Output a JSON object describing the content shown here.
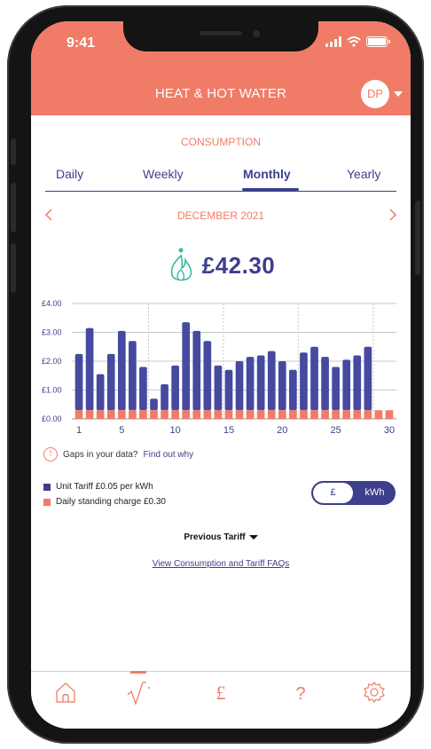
{
  "status_bar": {
    "time": "9:41"
  },
  "header": {
    "title": "HEAT & HOT WATER",
    "avatar_initials": "DP"
  },
  "section": {
    "title": "CONSUMPTION"
  },
  "tabs": [
    {
      "label": "Daily",
      "active": false
    },
    {
      "label": "Weekly",
      "active": false
    },
    {
      "label": "Monthly",
      "active": true
    },
    {
      "label": "Yearly",
      "active": false
    }
  ],
  "period": {
    "label": "DECEMBER 2021",
    "prev_icon": "chevron-left-icon",
    "next_icon": "chevron-right-icon"
  },
  "total": {
    "value": "£42.30",
    "icon": "flame-icon"
  },
  "chart_data": {
    "type": "bar",
    "stacked": true,
    "categories": [
      1,
      2,
      3,
      4,
      5,
      6,
      7,
      8,
      9,
      10,
      11,
      12,
      13,
      14,
      15,
      16,
      17,
      18,
      19,
      20,
      21,
      22,
      23,
      24,
      25,
      26,
      27,
      28,
      29,
      30
    ],
    "x_tick_labels": [
      "1",
      "5",
      "10",
      "15",
      "20",
      "25",
      "30"
    ],
    "y_tick_labels": [
      "£0.00",
      "£1.00",
      "£2.00",
      "£3.00",
      "£4.00"
    ],
    "ylim": [
      0,
      4
    ],
    "series": [
      {
        "name": "Daily standing charge £0.30",
        "color": "#f07c67",
        "values": [
          0.3,
          0.3,
          0.3,
          0.3,
          0.3,
          0.3,
          0.3,
          0.3,
          0.3,
          0.3,
          0.3,
          0.3,
          0.3,
          0.3,
          0.3,
          0.3,
          0.3,
          0.3,
          0.3,
          0.3,
          0.3,
          0.3,
          0.3,
          0.3,
          0.3,
          0.3,
          0.3,
          0.3,
          0.3,
          0.3
        ]
      },
      {
        "name": "Unit Tariff £0.05 per kWh",
        "color": "#454aa0",
        "values": [
          1.95,
          2.85,
          1.25,
          1.95,
          2.75,
          2.4,
          1.5,
          0.4,
          0.9,
          1.55,
          3.05,
          2.75,
          2.4,
          1.55,
          1.4,
          1.7,
          1.85,
          1.9,
          2.05,
          1.7,
          1.4,
          2.0,
          2.2,
          1.85,
          1.5,
          1.75,
          1.9,
          2.2
        ]
      }
    ],
    "grid": true
  },
  "gaps": {
    "text": "Gaps in your data?",
    "link": "Find out why"
  },
  "legend": [
    {
      "label": "Unit Tariff £0.05 per kWh",
      "color": "#3d3f8c"
    },
    {
      "label": "Daily standing charge £0.30",
      "color": "#f07c67"
    }
  ],
  "unit_toggle": {
    "left": "£",
    "right": "kWh",
    "selected": "£"
  },
  "previous_tariff": {
    "label": "Previous Tariff"
  },
  "faq": {
    "label": "View Consumption and Tariff FAQs"
  },
  "bottom_nav": [
    {
      "icon": "home-icon",
      "active": false
    },
    {
      "icon": "consumption-icon",
      "active": true
    },
    {
      "icon": "pound-icon",
      "active": false
    },
    {
      "icon": "help-icon",
      "active": false
    },
    {
      "icon": "gear-icon",
      "active": false
    }
  ],
  "colors": {
    "accent": "#f07c67",
    "primary": "#3d3f8c",
    "teal": "#3bb7a6"
  }
}
